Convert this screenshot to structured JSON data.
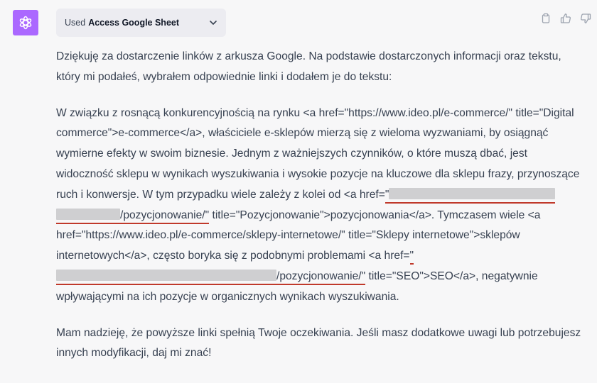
{
  "tool_pill": {
    "used_label": "Used",
    "tool_name": "Access Google Sheet"
  },
  "colors": {
    "avatar_bg": "#ab68ff",
    "underline": "#c0392b"
  },
  "icons": {
    "avatar": "openai-logo-icon",
    "chevron": "chevron-down-icon",
    "copy": "clipboard-icon",
    "like": "thumbs-up-icon",
    "dislike": "thumbs-down-icon"
  },
  "message": {
    "intro": "Dziękuję za dostarczenie linków z arkusza Google. Na podstawie dostarczonych informacji oraz tekstu, który mi podałeś, wybrałem odpowiednie linki i dodałem je do tekstu:",
    "body_part1": "W związku z rosnącą konkurencyjnością na rynku <a href=\"https://www.ideo.pl/e-commerce/\" title=\"Digital commerce\">e-commerce</a>, właściciele e-sklepów mierzą się z wieloma wyzwaniami, by osiągnąć wymierne efekty w swoim biznesie. Jednym z ważniejszych czynników, o które muszą dbać, jest widoczność sklepu w wynikach wyszukiwania i wysokie pozycje na kluczowe dla sklepu frazy, przynoszące ruch i konwersje. W tym przypadku wiele zależy z kolei od <a href=",
    "link1_quote": "\"",
    "link1_suffix": "/pozycjonowanie/\"",
    "body_part2": " title=\"Pozycjonowanie\">pozycjonowania</a>. Tymczasem wiele <a href=\"https://www.ideo.pl/e-commerce/sklepy-internetowe/\" title=\"Sklepy internetowe\">sklepów internetowych</a>, często boryka się z podobnymi problemami <a href=",
    "link2_quote": "\"",
    "link2_suffix": "/pozycjonowanie/\"",
    "body_part3": " title=\"SEO\">SEO</a>, negatywnie wpływającymi na ich pozycje w organicznych wynikach wyszukiwania.",
    "closing": "Mam nadzieję, że powyższe linki spełnią Twoje oczekiwania. Jeśli masz dodatkowe uwagi lub potrzebujesz innych modyfikacji, daj mi znać!"
  }
}
